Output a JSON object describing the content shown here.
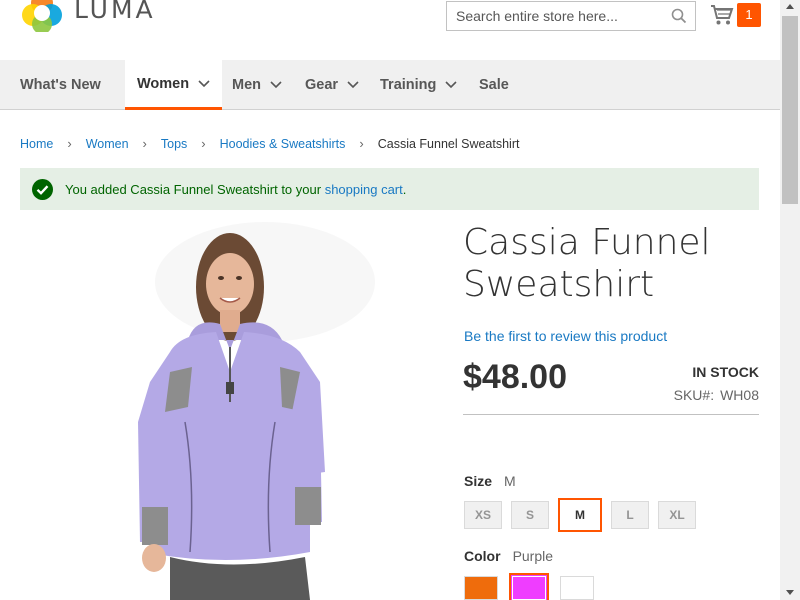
{
  "header": {
    "logo_text": "LUMA",
    "search": {
      "placeholder": "Search entire store here...",
      "value": ""
    },
    "cart": {
      "count": "1"
    }
  },
  "nav": {
    "items": [
      {
        "label": "What's New",
        "has_dropdown": false,
        "active": false
      },
      {
        "label": "Women",
        "has_dropdown": true,
        "active": true
      },
      {
        "label": "Men",
        "has_dropdown": true,
        "active": false
      },
      {
        "label": "Gear",
        "has_dropdown": true,
        "active": false
      },
      {
        "label": "Training",
        "has_dropdown": true,
        "active": false
      },
      {
        "label": "Sale",
        "has_dropdown": false,
        "active": false
      }
    ]
  },
  "breadcrumbs": [
    "Home",
    "Women",
    "Tops",
    "Hoodies & Sweatshirts",
    "Cassia Funnel Sweatshirt"
  ],
  "message": {
    "prefix": "You added Cassia Funnel Sweatshirt to your ",
    "link": "shopping cart",
    "suffix": "."
  },
  "product": {
    "title": "Cassia Funnel Sweatshirt",
    "review_link": "Be the first to review this product",
    "price": "$48.00",
    "stock": "In stock",
    "sku_label": "SKU#:",
    "sku": "WH08",
    "size": {
      "label": "Size",
      "selected": "M",
      "options": [
        "XS",
        "S",
        "M",
        "L",
        "XL"
      ]
    },
    "color": {
      "label": "Color",
      "selected": "Purple",
      "options": [
        {
          "name": "Orange",
          "hex": "#ef6c0c"
        },
        {
          "name": "Purple",
          "hex": "#ef3dff"
        },
        {
          "name": "White",
          "hex": "#ffffff"
        }
      ]
    }
  },
  "colors": {
    "accent": "#ff5501",
    "link": "#1979c3",
    "success_bg": "#e5efe5",
    "success_text": "#006400",
    "garment": "#b4a9e6"
  }
}
